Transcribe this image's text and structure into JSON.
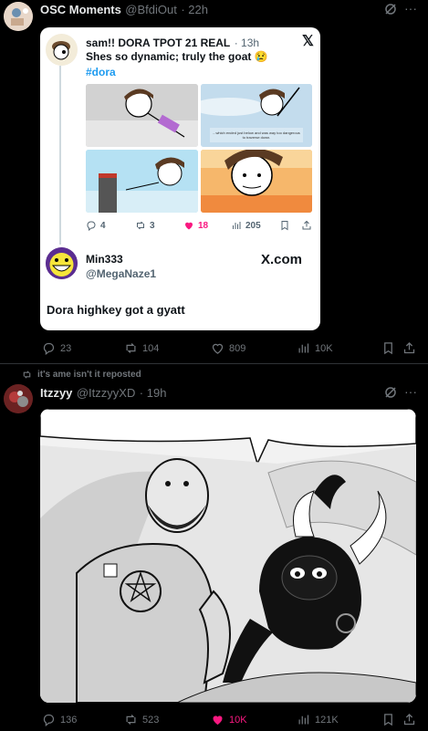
{
  "post1": {
    "author": "OSC Moments",
    "handle": "@BfdiOut",
    "time": "· 22h",
    "card": {
      "author": "sam!! DORA TPOT 21 REAL",
      "time": "· 13h",
      "text": "Shes so dynamic; truly the goat 😢",
      "hashtag": "#dora",
      "image_caption": "...which ended just below and was way too dangerous to traverse down.",
      "stats": {
        "replies": "4",
        "reposts": "3",
        "likes": "18",
        "views": "205"
      },
      "quoted": {
        "author": "Min333",
        "handle": "@MegaNaze1",
        "site": "X.com",
        "text": "Dora highkey got a gyatt"
      }
    },
    "stats": {
      "replies": "23",
      "reposts": "104",
      "likes": "809",
      "views": "10K"
    }
  },
  "post2": {
    "repost_label": "it's ame isn't it reposted",
    "author": "Itzzyy",
    "handle": "@ItzzyyXD",
    "time": "· 19h",
    "stats": {
      "replies": "136",
      "reposts": "523",
      "likes": "10K",
      "views": "121K"
    }
  },
  "colors": {
    "like_active": "#f91880",
    "link": "#1d9bf0",
    "background": "#000000"
  }
}
